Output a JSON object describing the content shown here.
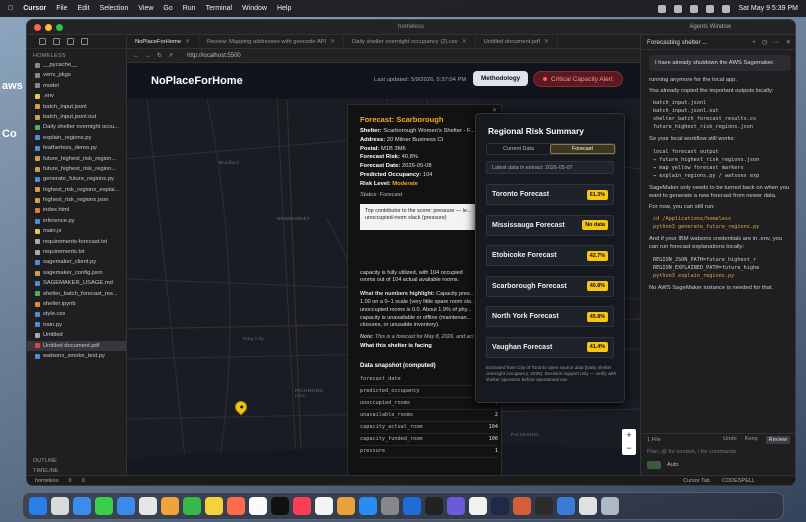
{
  "menubar": {
    "app": "Cursor",
    "items": [
      "File",
      "Edit",
      "Selection",
      "View",
      "Go",
      "Run",
      "Terminal",
      "Window",
      "Help"
    ],
    "clock": "Sat May 9  5:39 PM"
  },
  "desktop": {
    "labels": [
      "aws",
      "Co"
    ]
  },
  "window": {
    "title": "homeless",
    "agents_window": "Agents Window"
  },
  "sidebar": {
    "header": "HOMELESS",
    "files": [
      "__pycache__",
      "venv_pkgs",
      "model",
      ".env",
      "batch_input.jsonl",
      "batch_input.jsonl.out",
      "Daily shelter overnight occu...",
      "explain_regions.py",
      "featherless_demo.py",
      "future_highest_risk_region...",
      "future_highest_risk_region...",
      "generate_future_regions.py",
      "highest_risk_regions_explai...",
      "highest_risk_regions.json",
      "index.html",
      "inference.py",
      "main.js",
      "requirements-forecast.txt",
      "requirements.txt",
      "sagemaker_client.py",
      "sagemaker_config.json",
      "SAGEMAKER_USAGE.md",
      "shelter_batch_forecast_res...",
      "shelter.ipynb",
      "style.css",
      "train.py",
      "Untitled",
      "Untitled document.pdf",
      "watsonx_smoke_test.py"
    ],
    "outline": "OUTLINE",
    "timeline": "TIMELINE"
  },
  "statusbar": {
    "branch": "homeless",
    "errors": "0",
    "warnings": "0",
    "cursor_tab": "Cursor Tab",
    "codespell": "CODESPELL"
  },
  "tabs": [
    {
      "label": "NoPlaceForHome",
      "active": true
    },
    {
      "label": "Review: Mapping addresses with geocode API",
      "active": false
    },
    {
      "label": "Daily shelter overnight occupancy (2).csv",
      "active": false
    },
    {
      "label": "Untitled document.pdf",
      "active": false
    }
  ],
  "browser": {
    "url": "http://localhost:5500"
  },
  "site": {
    "brand": "NoPlaceForHome",
    "last_updated": "Last updated: 5/9/2026, 5:37:04 PM",
    "methodology": "Methodology",
    "alert": "Critical Capacity Alert"
  },
  "map": {
    "labels": [
      "Bradford",
      "NEWMARKET",
      "King City",
      "RICHMOND HILL",
      "PICKERING"
    ],
    "zoom_in": "+",
    "zoom_out": "−"
  },
  "popup": {
    "title": "Forecast: Scarborough",
    "fields": [
      {
        "k": "Shelter:",
        "v": "Scarborough Women's Shelter - F..."
      },
      {
        "k": "Address:",
        "v": "20 Milner Business Ct"
      },
      {
        "k": "Postal:",
        "v": "M1B 3M6"
      },
      {
        "k": "Forecast Risk:",
        "v": "40.8%"
      },
      {
        "k": "Forecast Date:",
        "v": "2026-05-08"
      },
      {
        "k": "Predicted Occupancy:",
        "v": "104"
      }
    ],
    "risk_label": "Risk Level:",
    "risk_value": "Moderate",
    "status": "Status: Forecast",
    "contributor": "Top contributor to the score: pressure — le... unoccupied-room slack (pressure)",
    "p1": "capacity is fully utilized, with 104 occupied",
    "p2": "rooms out of 104 actual available rooms.",
    "h_label": "What the numbers highlight:",
    "h_text": " Capacity pres...",
    "h2": "1.00 on a 0–1 scale (very little spare room sla...",
    "h3": "unoccupied rooms is 0.0. About 1.9% of phy...",
    "h4": "capacity is unavailable or offline (maintenan...",
    "h5": "closures, or unusable inventory).",
    "note_label": "Note:",
    "note_text": " This is a forecast for May 8, 2026, and act...",
    "facing": "What this shelter is facing",
    "snapshot_title": "Data snapshot (computed)",
    "snapshot": [
      {
        "k": "forecast_date",
        "v": "202..."
      },
      {
        "k": "predicted_occupancy",
        "v": "104"
      },
      {
        "k": "unoccupied_rooms",
        "v": "0"
      },
      {
        "k": "unavailable_rooms",
        "v": "2"
      },
      {
        "k": "capacity_actual_room",
        "v": "104"
      },
      {
        "k": "capacity_funded_room",
        "v": "106"
      },
      {
        "k": "pressure",
        "v": "1"
      }
    ]
  },
  "risk_panel": {
    "title": "Regional Risk Summary",
    "tabs": [
      "Current Data",
      "Forecast"
    ],
    "active_tab": "Forecast",
    "extract": "Latest data in extract: 2026-05-07",
    "regions": [
      {
        "name": "Toronto Forecast",
        "value": "61.3%"
      },
      {
        "name": "Mississauga Forecast",
        "value": "No data"
      },
      {
        "name": "Etobicoke Forecast",
        "value": "42.7%"
      },
      {
        "name": "Scarborough Forecast",
        "value": "40.8%"
      },
      {
        "name": "North York Forecast",
        "value": "45.8%"
      },
      {
        "name": "Vaughan Forecast",
        "value": "41.4%"
      }
    ],
    "footer": "Extracted from City of Toronto open source data (Daily shelter overnight occupancy, 2026). Decision support only — verify with shelter operators before operational use."
  },
  "chat": {
    "title": "Forecasting shelter ...",
    "bubble": "I have already shutdown the AWS Sagemaker.",
    "m1": "running anymore for the local app.",
    "m2": "You already copied the important outputs locally:",
    "code1": "batch_input.jsonl\nbatch_input.jsonl.out\nshelter_batch_forecast_results.cs\nfuture_highest_risk_regions.json",
    "m3": "So your local workflow still works:",
    "code2": "local forecast output\n→ future_highest_risk_regions.json\n→ map yellow forecast markers\n→ explain_regions.py / watsonx exp",
    "m4": "SageMaker only needs to be turned back on when you want to generate a new forecast from newer data.",
    "m5": "For now, you can still run:",
    "code3a": "cd /Applications/homeless",
    "code3b": "python3 generate_future_regions.py",
    "m6": "And if your IBM watsonx credentials are in .env, you can run forecast explanations locally:",
    "code4a": "REGION_JSON_PATH=future_highest_r",
    "code4b": "REGION_EXPLAINED_PATH=future_highe",
    "code4c": "python3 explain_regions.py",
    "m7": "No AWS SageMaker instance is needed for that.",
    "files": "1 File",
    "undo": "Undo",
    "keep": "Keep",
    "review": "Review",
    "input_placeholder": "Plan, @ for context, / for commands",
    "mode": "Auto"
  },
  "colors": {
    "accent": "#f5a623",
    "badge": "#f5c518",
    "alert": "#ff9090"
  }
}
